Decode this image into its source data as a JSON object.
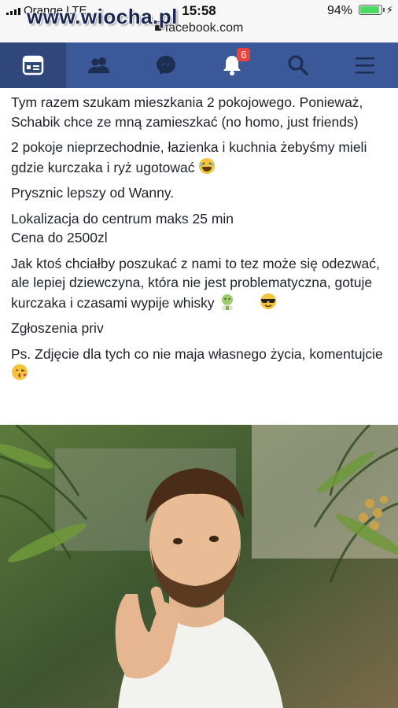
{
  "watermark": "www.wiocha.pl",
  "status_bar": {
    "carrier": "Orange",
    "network": "LTE",
    "time": "15:58",
    "battery_percent": "94%",
    "battery_level": 0.94,
    "url": "facebook.com"
  },
  "navbar": {
    "items": [
      {
        "icon": "news-feed-icon",
        "active": true
      },
      {
        "icon": "friends-icon",
        "active": false
      },
      {
        "icon": "messenger-icon",
        "active": false
      },
      {
        "icon": "notifications-icon",
        "badge": "6",
        "active": false
      },
      {
        "icon": "search-icon",
        "active": false
      },
      {
        "icon": "menu-icon",
        "active": false
      }
    ],
    "color": "#3b5998"
  },
  "post": {
    "paragraphs": [
      "Tym razem szukam mieszkania 2 pokojowego. Ponieważ, Schabik chce ze mną zamieszkać (no homo, just friends)",
      "2 pokoje nieprzechodnie, łazienka i kuchnia żebyśmy mieli gdzie kurczaka i ryż ugotować",
      "Prysznic lepszy od Wanny.",
      "Lokalizacja do centrum maks 25 min",
      "Cena do 2500zl",
      "Jak ktoś chciałby poszukać z nami to tez może się odezwać, ale lepiej dziewczyna, która nie jest problematyczna, gotuje kurczaka i czasami wypije whisky",
      "Zgłoszenia priv",
      "Ps. Zdjęcie dla tych co nie maja własnego życia, komentujcie"
    ],
    "emojis": {
      "laughing": "laughing-emoji",
      "nauseated": "nauseated-face-emoji",
      "sunglasses": "sunglasses-emoji",
      "kiss": "kissing-face-emoji"
    }
  },
  "photo": {
    "subject": "man-gesturing-photo"
  }
}
